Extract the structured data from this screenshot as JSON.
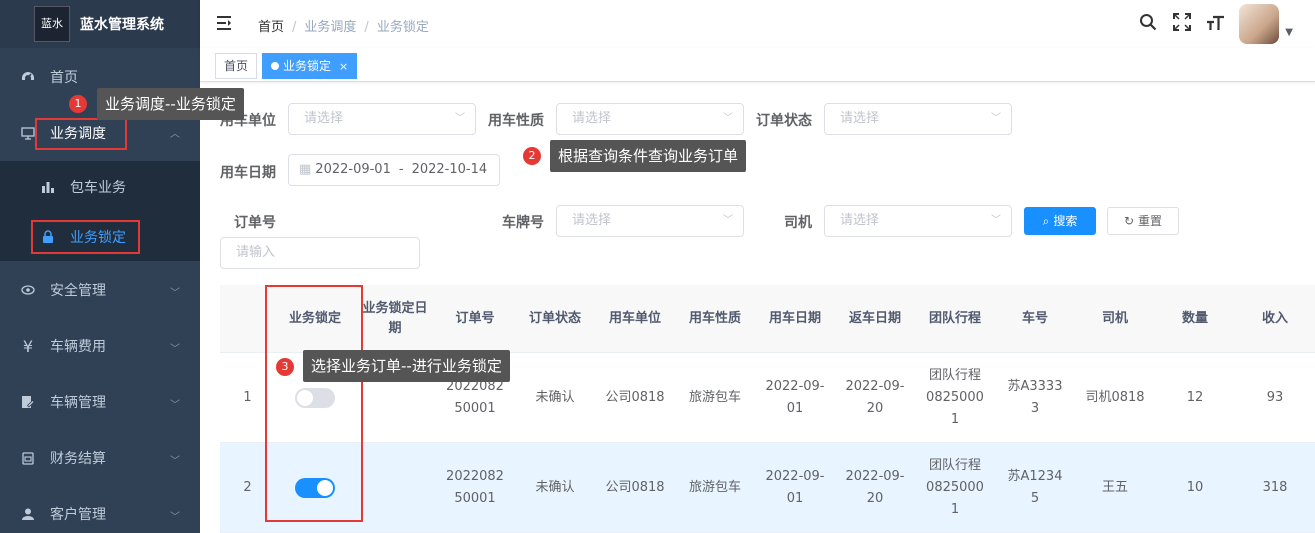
{
  "sidebar": {
    "logo_text": "蓝水",
    "title": "蓝水管理系统",
    "items": [
      {
        "label": "首页",
        "icon": "dashboard-icon"
      },
      {
        "label": "业务调度",
        "icon": "monitor-icon"
      },
      {
        "label": "安全管理",
        "icon": "eye-icon"
      },
      {
        "label": "车辆费用",
        "icon": "yen-icon"
      },
      {
        "label": "车辆管理",
        "icon": "document-edit-icon"
      },
      {
        "label": "财务结算",
        "icon": "clipboard-icon"
      },
      {
        "label": "客户管理",
        "icon": "user-icon"
      }
    ],
    "sub_items": [
      {
        "label": "包车业务",
        "icon": "bar-chart-icon"
      },
      {
        "label": "业务锁定",
        "icon": "lock-icon"
      }
    ]
  },
  "breadcrumb": [
    "首页",
    "业务调度",
    "业务锁定"
  ],
  "tags": {
    "home": "首页",
    "active": "业务锁定",
    "close": "×"
  },
  "form": {
    "unit_label": "用车单位",
    "unit_placeholder": "请选择",
    "nature_label": "用车性质",
    "nature_placeholder": "请选择",
    "status_label": "订单状态",
    "status_placeholder": "请选择",
    "date_label": "用车日期",
    "date_start": "2022-09-01",
    "date_sep": "-",
    "date_end": "2022-10-14",
    "order_label": "订单号",
    "order_placeholder": "请输入",
    "plate_label": "车牌号",
    "plate_placeholder": "请选择",
    "driver_label": "司机",
    "driver_placeholder": "请选择",
    "search_btn": "搜索",
    "reset_btn": "重置"
  },
  "table": {
    "headers": [
      "业务锁定",
      "业务锁定日期",
      "订单号",
      "订单状态",
      "用车单位",
      "用车性质",
      "用车日期",
      "返车日期",
      "团队行程",
      "车号",
      "司机",
      "数量",
      "收入"
    ],
    "rows": [
      {
        "index": "1",
        "locked": false,
        "lock_date": "",
        "order_no": "2022082 50001",
        "status": "未确认",
        "unit": "公司0818",
        "nature": "旅游包车",
        "use_date": "2022-09- 01",
        "return_date": "2022-09- 20",
        "trip": "团队行程 0825000 1",
        "plate": "苏A3333 3",
        "driver": "司机0818",
        "qty": "12",
        "income": "93"
      },
      {
        "index": "2",
        "locked": true,
        "lock_date": "",
        "order_no": "2022082 50001",
        "status": "未确认",
        "unit": "公司0818",
        "nature": "旅游包车",
        "use_date": "2022-09- 01",
        "return_date": "2022-09- 20",
        "trip": "团队行程 0825000 1",
        "plate": "苏A1234 5",
        "driver": "王五",
        "qty": "10",
        "income": "318"
      }
    ]
  },
  "annotations": [
    {
      "num": "1",
      "text": "业务调度--业务锁定"
    },
    {
      "num": "2",
      "text": "根据查询条件查询业务订单"
    },
    {
      "num": "3",
      "text": "选择业务订单--进行业务锁定"
    }
  ],
  "colors": {
    "sidebar_bg": "#304156",
    "accent": "#1890ff",
    "annotation_red": "#e53935"
  }
}
